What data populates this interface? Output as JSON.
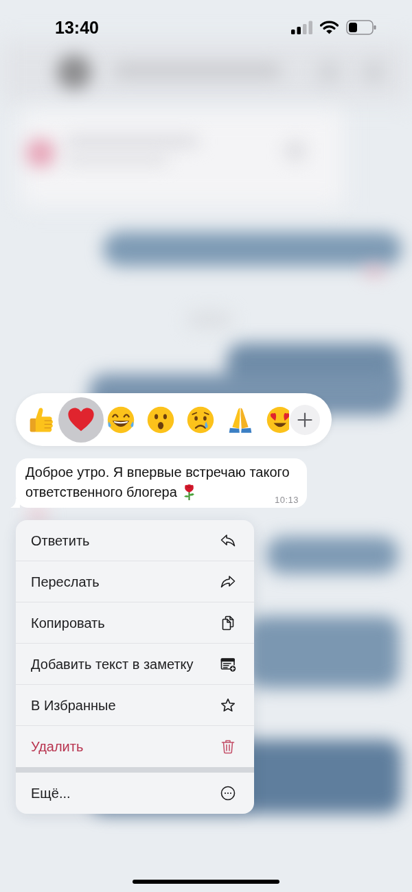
{
  "status_bar": {
    "time": "13:40"
  },
  "reactions": [
    {
      "kind": "thumbs_up",
      "selected": false
    },
    {
      "kind": "heart",
      "selected": true
    },
    {
      "kind": "tears_of_joy",
      "selected": false
    },
    {
      "kind": "surprised",
      "selected": false
    },
    {
      "kind": "crying",
      "selected": false
    },
    {
      "kind": "folded_hands",
      "selected": false
    },
    {
      "kind": "heart_eyes",
      "selected": false
    }
  ],
  "message": {
    "lines": [
      "Доброе утро. Я впервые встречаю такого",
      "ответственного блогера"
    ],
    "trailing_icon": {
      "kind": "rose"
    },
    "time": "10:13"
  },
  "menu": {
    "items": [
      {
        "label": "Ответить",
        "kind": "reply",
        "destructive": false,
        "separated": false
      },
      {
        "label": "Переслать",
        "kind": "forward",
        "destructive": false,
        "separated": false
      },
      {
        "label": "Копировать",
        "kind": "copy",
        "destructive": false,
        "separated": false
      },
      {
        "label": "Добавить текст в заметку",
        "kind": "add_note",
        "destructive": false,
        "separated": false
      },
      {
        "label": "В Избранные",
        "kind": "favorite",
        "destructive": false,
        "separated": false
      },
      {
        "label": "Удалить",
        "kind": "delete",
        "destructive": true,
        "separated": false
      },
      {
        "label": "Ещё...",
        "kind": "more",
        "destructive": false,
        "separated": true
      }
    ]
  }
}
